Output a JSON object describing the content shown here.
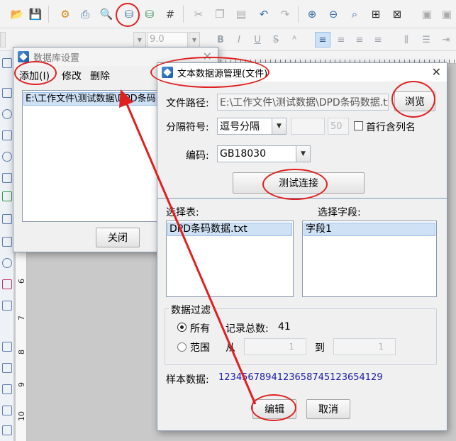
{
  "toolbar": {
    "icons": [
      "open-icon",
      "save-icon",
      "settings-icon",
      "print-icon",
      "print-preview-icon",
      "database-icon",
      "database-add-icon",
      "grid-icon",
      "cut-icon",
      "copy-icon",
      "paste-icon",
      "undo-icon",
      "redo-icon",
      "zoom-in-icon",
      "zoom-out-icon",
      "zoom-fit-icon",
      "fit-page-icon",
      "actual-size-icon",
      "align-icon"
    ]
  },
  "format_bar": {
    "font_size": "9.0",
    "bold": "B",
    "italic": "I",
    "underline": "U",
    "strike": "S"
  },
  "ruler": {
    "marks": [
      "6",
      "7",
      "8",
      "9",
      "10"
    ]
  },
  "db_dialog": {
    "title": "数据库设置",
    "menu_add": "添加(I)",
    "menu_edit": "修改",
    "menu_delete": "删除",
    "list_item": "E:\\工作文件\\测试数据\\DPD条码",
    "close_button": "关闭"
  },
  "text_dialog": {
    "title": "文本数据源管理(文件)",
    "file_path_label": "文件路径:",
    "file_path_value": "E:\\工作文件\\测试数据\\DPD条码数据.txt",
    "browse_button": "浏览",
    "separator_label": "分隔符号:",
    "separator_value": "逗号分隔",
    "separator_custom": "",
    "separator_num": "50",
    "first_row_header_label": "首行含列名",
    "encoding_label": "编码:",
    "encoding_value": "GB18030",
    "test_button": "测试连接",
    "select_table_label": "选择表:",
    "table_item": "DPD条码数据.txt",
    "select_field_label": "选择字段:",
    "field_item": "字段1",
    "filter_group_label": "数据过滤",
    "filter_all": "所有",
    "record_total_label": "记录总数:",
    "record_total_value": "41",
    "filter_range": "范围",
    "from_label": "从",
    "from_value": "1",
    "to_label": "到",
    "to_value": "1",
    "sample_label": "样本数据:",
    "sample_value": "12345678941236587451236541​29",
    "edit_button": "编辑",
    "cancel_button": "取消"
  },
  "colors": {
    "annotation": "#e02020",
    "sample_text": "#1a1aa6"
  }
}
